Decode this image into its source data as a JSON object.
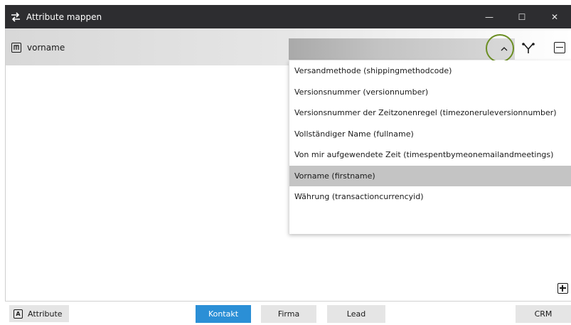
{
  "window": {
    "title": "Attribute mappen",
    "controls": {
      "minimize": "—",
      "maximize": "☐",
      "close": "✕"
    }
  },
  "attribute_row": {
    "name": "vorname",
    "icon": "m-box-icon"
  },
  "dropdown": {
    "items": [
      "Versandmethode (shippingmethodcode)",
      "Versionsnummer (versionnumber)",
      "Versionsnummer der Zeitzonenregel (timezoneruleversionnumber)",
      "Vollständiger Name (fullname)",
      "Von mir aufgewendete Zeit (timespentbymeonemailandmeetings)",
      "Vorname (firstname)",
      "Währung (transactioncurrencyid)"
    ],
    "selected_index": 5
  },
  "bottom": {
    "attribute_button": "Attribute",
    "tabs": [
      {
        "label": "Kontakt",
        "active": true
      },
      {
        "label": "Firma",
        "active": false
      },
      {
        "label": "Lead",
        "active": false
      },
      {
        "label": "CRM",
        "active": false
      }
    ]
  },
  "colors": {
    "titlebar": "#2d2d30",
    "accent": "#2b8fd6",
    "highlight_ring": "#6b8e23",
    "selected_item": "#c4c4c4"
  }
}
